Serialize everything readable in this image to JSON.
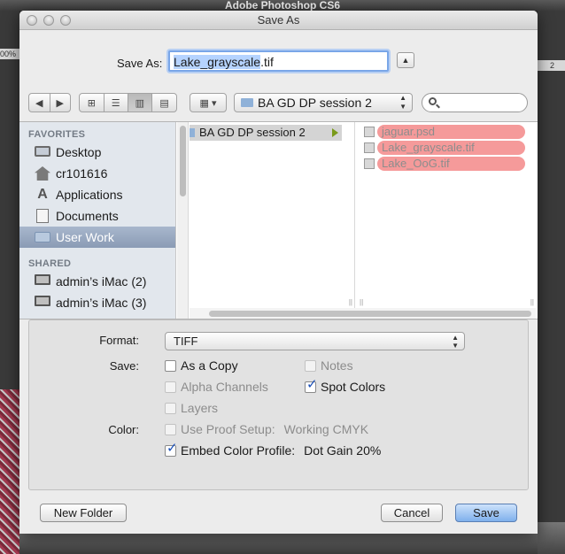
{
  "app": {
    "title": "Adobe Photoshop CS6",
    "ruler_left": "00%",
    "ruler_right": "2"
  },
  "dialog": {
    "title": "Save As"
  },
  "save_as": {
    "label": "Save As:",
    "filename_selected": "Lake_grayscale",
    "filename_ext": ".tif"
  },
  "toolbar": {
    "back": "◀",
    "forward": "▶",
    "view_icon": "⊞",
    "view_list": "☰",
    "view_columns": "▥",
    "view_coverflow": "▤",
    "arrange": "▦ ▾",
    "current_folder": "BA GD DP session 2"
  },
  "sidebar": {
    "favorites_heading": "FAVORITES",
    "shared_heading": "SHARED",
    "favorites": [
      {
        "label": "Desktop",
        "icon": "desktop-icon"
      },
      {
        "label": "cr101616",
        "icon": "home-icon"
      },
      {
        "label": "Applications",
        "icon": "applications-icon"
      },
      {
        "label": "Documents",
        "icon": "documents-icon"
      },
      {
        "label": "User Work",
        "icon": "folder-icon",
        "selected": true
      }
    ],
    "shared": [
      {
        "label": "admin’s iMac (2)",
        "icon": "imac-icon"
      },
      {
        "label": "admin’s iMac (3)",
        "icon": "imac-icon"
      }
    ]
  },
  "columns": {
    "col1": [
      "BA GD DP session 2"
    ],
    "col2": [
      "jaguar.psd",
      "Lake_grayscale.tif",
      "Lake_OoG.tif"
    ],
    "label_color": "#f59a9a"
  },
  "options": {
    "format_label": "Format:",
    "format_value": "TIFF",
    "save_label": "Save:",
    "color_label": "Color:",
    "as_a_copy": {
      "label": "As a Copy",
      "checked": false,
      "enabled": true
    },
    "notes": {
      "label": "Notes",
      "checked": false,
      "enabled": false
    },
    "alpha_channels": {
      "label": "Alpha Channels",
      "checked": false,
      "enabled": false
    },
    "spot_colors": {
      "label": "Spot Colors",
      "checked": true,
      "enabled": true
    },
    "layers": {
      "label": "Layers",
      "checked": false,
      "enabled": false
    },
    "use_proof_setup": {
      "label": "Use Proof Setup:",
      "value": "Working CMYK",
      "checked": false,
      "enabled": false
    },
    "embed_color_profile": {
      "label": "Embed Color Profile:",
      "value": "Dot Gain 20%",
      "checked": true,
      "enabled": true
    }
  },
  "buttons": {
    "new_folder": "New Folder",
    "cancel": "Cancel",
    "save": "Save"
  },
  "colors": {
    "accent": "#7fb0ec",
    "focus_ring": "#79a6e8",
    "sidebar_selected": "#8a9bb5"
  }
}
